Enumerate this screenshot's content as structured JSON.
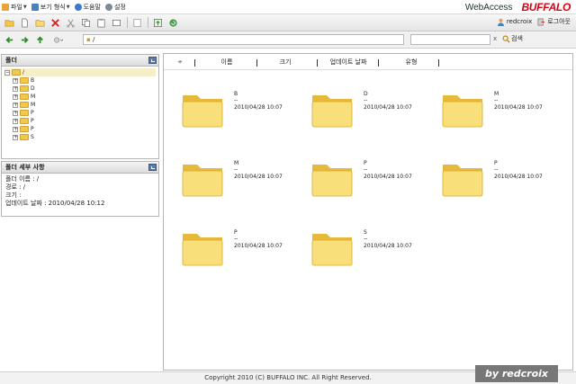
{
  "menu": [
    {
      "label": "파일",
      "icon": "file-icon",
      "color": "#e8a33a"
    },
    {
      "label": "보기 형식",
      "icon": "view-icon",
      "color": "#4a7fc0"
    },
    {
      "label": "도움말",
      "icon": "help-icon",
      "color": "#3f78c9"
    },
    {
      "label": "설정",
      "icon": "gear-icon",
      "color": "#7d8a99"
    }
  ],
  "brand": {
    "webaccess": "WebAccess",
    "logo": "BUFFALO",
    "logo_color": "#d90012"
  },
  "user": {
    "name": "redcroix",
    "logout": "로그아웃"
  },
  "address": {
    "path": "/",
    "search_placeholder": "",
    "clear": "x",
    "search_label": "검색"
  },
  "folder_panel": {
    "title": "폴더"
  },
  "tree": {
    "root": "/",
    "children": [
      "B",
      "D",
      "M",
      "M",
      "P",
      "P",
      "P",
      "S"
    ]
  },
  "details_panel": {
    "title": "폴더 세부 사항",
    "name_line": "폴더 이름 : /",
    "path_line": "경로 : /",
    "size_line": "크기 :",
    "updated_line": "업데이트 날짜 : 2010/04/28 10:12"
  },
  "columns": {
    "sort": "÷",
    "name": "이름",
    "size": "크기",
    "updated": "업데이트 날짜",
    "type": "유형"
  },
  "items": [
    {
      "name": "B",
      "size": "--",
      "date": "2010/04/28 10:07"
    },
    {
      "name": "D",
      "size": "--",
      "date": "2010/04/28 10:07"
    },
    {
      "name": "M",
      "size": "--",
      "date": "2010/04/28 10:07"
    },
    {
      "name": "M",
      "size": "--",
      "date": "2010/04/28 10:07"
    },
    {
      "name": "P",
      "size": "--",
      "date": "2010/04/28 10:07"
    },
    {
      "name": "P",
      "size": "--",
      "date": "2010/04/28 10:07"
    },
    {
      "name": "P",
      "size": "--",
      "date": "2010/04/28 10:07"
    },
    {
      "name": "S",
      "size": "--",
      "date": "2010/04/28 10:07"
    }
  ],
  "footer": {
    "copyright": "Copyright 2010 (C) BUFFALO INC. All Right Reserved."
  },
  "watermark": {
    "text": "by redcroix"
  },
  "colors": {
    "folder_light": "#f9df7a",
    "folder_dark": "#e8b83a",
    "accent": "#5a7aa8"
  }
}
